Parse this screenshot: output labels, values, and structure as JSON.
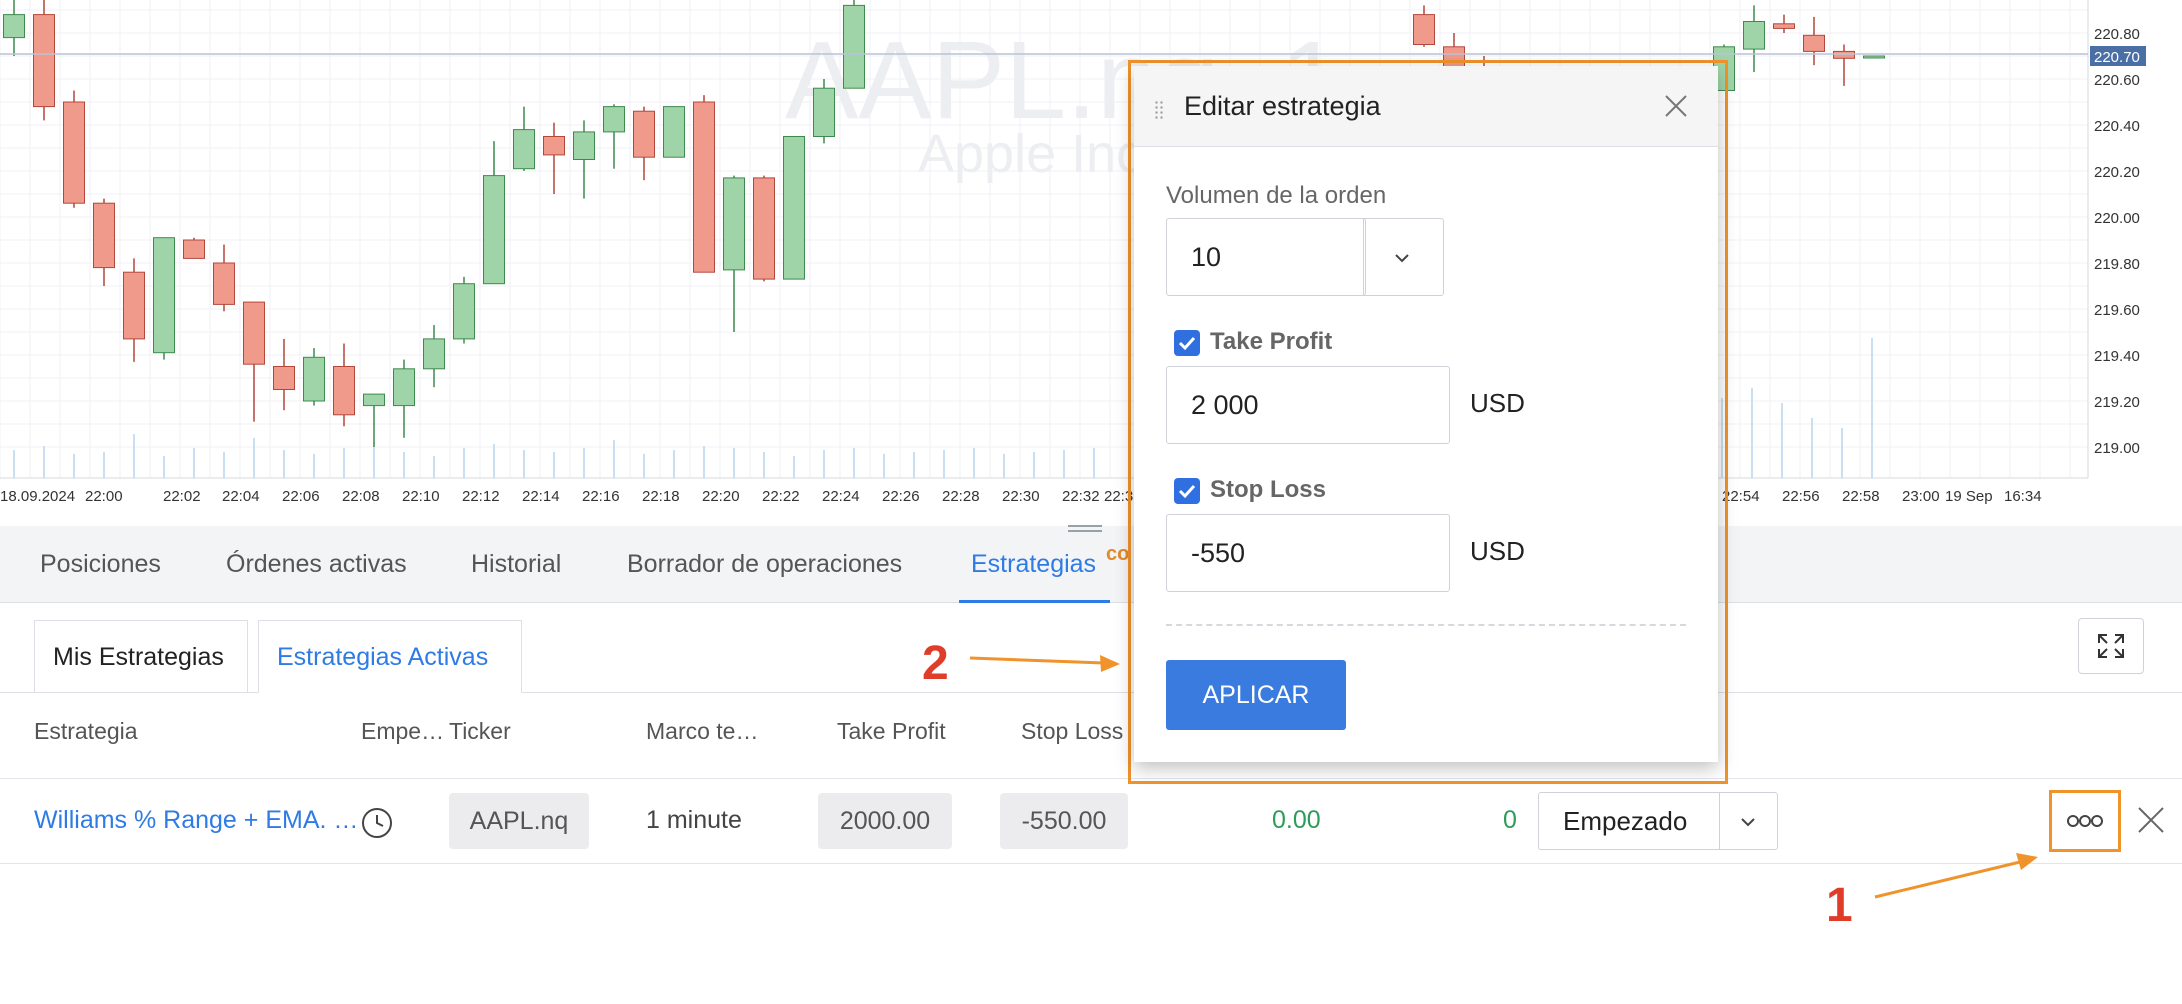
{
  "chart": {
    "symbol_watermark": "AAPL.nq, 1",
    "company_watermark": "Apple Inc.",
    "up_color": "#9fd4a8",
    "down_color": "#ef9a8a",
    "price_labels": [
      "220.80",
      "220.70",
      "220.60",
      "220.40",
      "220.20",
      "220.00",
      "219.80",
      "219.60",
      "219.40",
      "219.20",
      "219.00"
    ],
    "current_price": "220.70",
    "time_labels": [
      "18.09.2024",
      "22:00",
      "22:02",
      "22:04",
      "22:06",
      "22:08",
      "22:10",
      "22:12",
      "22:14",
      "22:16",
      "22:18",
      "22:20",
      "22:22",
      "22:24",
      "22:26",
      "22:28",
      "22:30",
      "22:32",
      "22:3",
      "22:54",
      "22:56",
      "22:58",
      "23:00",
      "19 Sep",
      "16:34"
    ],
    "candles": [
      {
        "o": 220.78,
        "c": 220.88,
        "h": 220.95,
        "l": 220.7
      },
      {
        "o": 220.88,
        "c": 220.48,
        "h": 220.95,
        "l": 220.42
      },
      {
        "o": 220.5,
        "c": 220.06,
        "h": 220.55,
        "l": 220.04
      },
      {
        "o": 220.06,
        "c": 219.78,
        "h": 220.08,
        "l": 219.7
      },
      {
        "o": 219.76,
        "c": 219.47,
        "h": 219.82,
        "l": 219.37
      },
      {
        "o": 219.41,
        "c": 219.91,
        "h": 219.91,
        "l": 219.38
      },
      {
        "o": 219.9,
        "c": 219.82,
        "h": 219.91,
        "l": 219.82
      },
      {
        "o": 219.8,
        "c": 219.62,
        "h": 219.88,
        "l": 219.59
      },
      {
        "o": 219.63,
        "c": 219.36,
        "h": 219.63,
        "l": 219.11
      },
      {
        "o": 219.35,
        "c": 219.25,
        "h": 219.47,
        "l": 219.16
      },
      {
        "o": 219.2,
        "c": 219.39,
        "h": 219.43,
        "l": 219.18
      },
      {
        "o": 219.35,
        "c": 219.14,
        "h": 219.45,
        "l": 219.09
      },
      {
        "o": 219.18,
        "c": 219.23,
        "h": 219.23,
        "l": 219.0
      },
      {
        "o": 219.18,
        "c": 219.34,
        "h": 219.38,
        "l": 219.04
      },
      {
        "o": 219.34,
        "c": 219.47,
        "h": 219.53,
        "l": 219.26
      },
      {
        "o": 219.47,
        "c": 219.71,
        "h": 219.74,
        "l": 219.45
      },
      {
        "o": 219.71,
        "c": 220.18,
        "h": 220.33,
        "l": 219.71
      },
      {
        "o": 220.21,
        "c": 220.38,
        "h": 220.48,
        "l": 220.2
      },
      {
        "o": 220.35,
        "c": 220.27,
        "h": 220.41,
        "l": 220.1
      },
      {
        "o": 220.25,
        "c": 220.37,
        "h": 220.42,
        "l": 220.08
      },
      {
        "o": 220.37,
        "c": 220.48,
        "h": 220.49,
        "l": 220.21
      },
      {
        "o": 220.46,
        "c": 220.26,
        "h": 220.48,
        "l": 220.16
      },
      {
        "o": 220.26,
        "c": 220.48,
        "h": 220.48,
        "l": 220.26
      },
      {
        "o": 220.5,
        "c": 219.76,
        "h": 220.53,
        "l": 219.76
      },
      {
        "o": 219.77,
        "c": 220.17,
        "h": 220.18,
        "l": 219.5
      },
      {
        "o": 220.17,
        "c": 219.73,
        "h": 220.18,
        "l": 219.72
      },
      {
        "o": 219.73,
        "c": 220.35,
        "h": 220.35,
        "l": 219.73
      },
      {
        "o": 220.35,
        "c": 220.56,
        "h": 220.6,
        "l": 220.32
      },
      {
        "o": 220.56,
        "c": 220.92,
        "h": 221.1,
        "l": 220.56
      }
    ],
    "right_candles": [
      {
        "o": 220.88,
        "c": 220.75,
        "h": 220.92,
        "l": 220.74
      },
      {
        "o": 220.74,
        "c": 220.6,
        "h": 220.8,
        "l": 220.55
      },
      {
        "o": 220.65,
        "c": 220.58,
        "h": 220.7,
        "l": 220.55
      },
      {
        "o": 220.55,
        "c": 220.74,
        "h": 220.75,
        "l": 220.55
      },
      {
        "o": 220.73,
        "c": 220.85,
        "h": 220.92,
        "l": 220.63
      },
      {
        "o": 220.84,
        "c": 220.82,
        "h": 220.88,
        "l": 220.8
      },
      {
        "o": 220.79,
        "c": 220.72,
        "h": 220.87,
        "l": 220.66
      },
      {
        "o": 220.72,
        "c": 220.69,
        "h": 220.75,
        "l": 220.57
      },
      {
        "o": 220.7,
        "c": 220.7,
        "h": 220.7,
        "l": 220.7
      }
    ]
  },
  "tabs": [
    {
      "label": "Posiciones",
      "active": false
    },
    {
      "label": "Órdenes activas",
      "active": false
    },
    {
      "label": "Historial",
      "active": false
    },
    {
      "label": "Borrador de operaciones",
      "active": false
    },
    {
      "label": "Estrategias",
      "active": true
    }
  ],
  "hidden_tab_fragment": "co",
  "subtabs": {
    "my": "Mis Estrategias",
    "active": "Estrategias Activas"
  },
  "columns": {
    "strategy": "Estrategia",
    "started": "Empe…",
    "ticker": "Ticker",
    "timeframe": "Marco te…",
    "take_profit": "Take Profit",
    "stop_loss": "Stop Loss"
  },
  "row": {
    "strategy": "Williams % Range + EMA. …",
    "ticker": "AAPL.nq",
    "timeframe": "1 minute",
    "take_profit": "2000.00",
    "stop_loss": "-550.00",
    "pnl": "0.00",
    "trades": "0",
    "status": "Empezado"
  },
  "annotations": {
    "one": "1",
    "two": "2",
    "color": "#f0932b"
  },
  "modal": {
    "title": "Editar estrategia",
    "volume_label": "Volumen de la orden",
    "volume_value": "10",
    "take_profit_label": "Take Profit",
    "take_profit_value": "2 000",
    "take_profit_checked": true,
    "stop_loss_label": "Stop Loss",
    "stop_loss_value": "-550",
    "stop_loss_checked": true,
    "currency": "USD",
    "apply_label": "APLICAR"
  },
  "accent_color": "#2f7be5"
}
